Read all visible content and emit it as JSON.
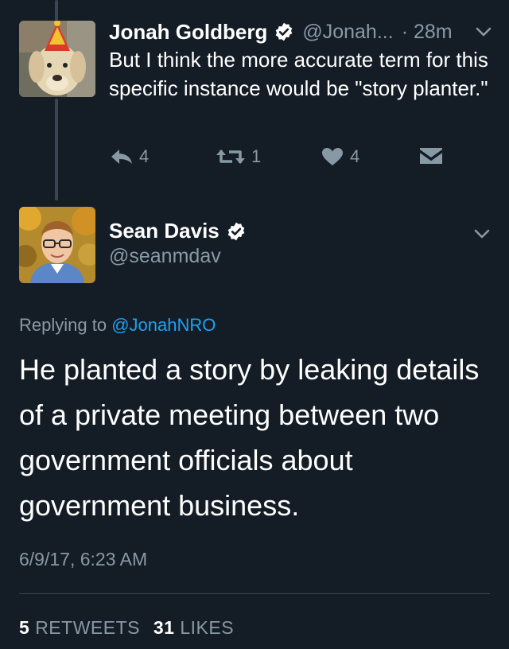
{
  "parent_tweet": {
    "author_name": "Jonah Goldberg",
    "handle": "@Jonah...",
    "time": "· 28m",
    "text": "But I think the more accurate term for this specific instance would be \"story planter.\"",
    "reply_count": "4",
    "retweet_count": "1",
    "like_count": "4"
  },
  "main_tweet": {
    "author_name": "Sean Davis",
    "handle": "@seanmdav",
    "replying_prefix": "Replying to",
    "replying_to": "@JonahNRO",
    "text": "He planted a story by leaking details of a private meeting between two government officials about government business.",
    "timestamp": "6/9/17, 6:23 AM",
    "retweets_count": "5",
    "retweets_label": "RETWEETS",
    "likes_count": "31",
    "likes_label": "LIKES"
  },
  "colors": {
    "background": "#141d26",
    "secondary_text": "#8899a6",
    "link": "#1da1f2"
  }
}
